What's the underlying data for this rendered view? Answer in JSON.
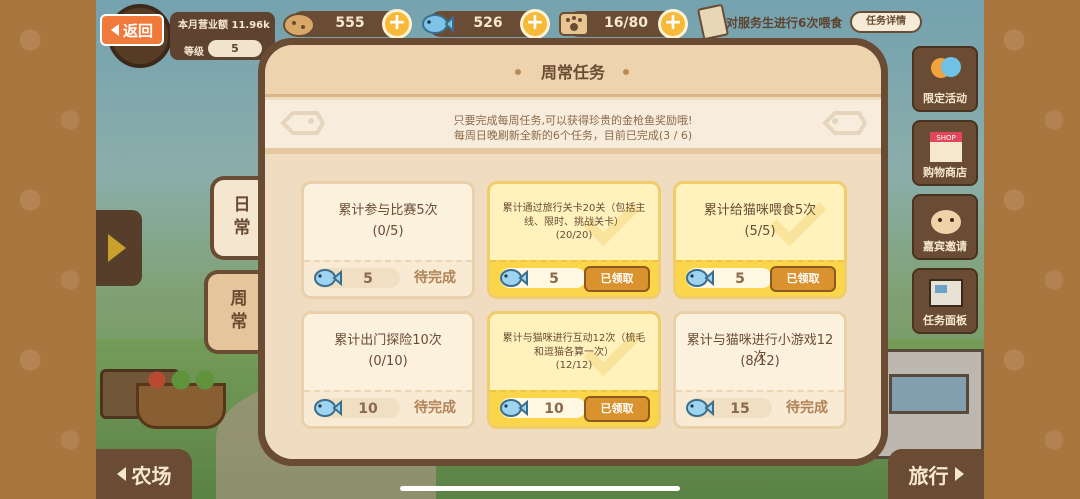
{
  "topbar": {
    "back_label": "返回",
    "revenue_label": "本月营业额 11.96k",
    "level_label": "等级",
    "level_value": "5",
    "cookies": "555",
    "fish": "526",
    "paw": "16/80",
    "task_text": "对服务生进行6次喂食",
    "task_detail_label": "任务详情"
  },
  "side_menu": [
    {
      "label": "限定活动",
      "icon": "balloon-icon"
    },
    {
      "label": "购物商店",
      "icon": "shop-icon"
    },
    {
      "label": "嘉宾邀请",
      "icon": "hamster-icon"
    },
    {
      "label": "任务面板",
      "icon": "board-icon"
    }
  ],
  "bottom_nav": {
    "left_label": "农场",
    "right_label": "旅行"
  },
  "tabs": {
    "daily": "日常",
    "weekly": "周常"
  },
  "modal": {
    "title": "周常任务",
    "desc_line1": "只要完成每周任务,可以获得珍贵的金枪鱼奖励哦!",
    "desc_line2": "每周日晚刷新全新的6个任务，目前已完成(3 / 6)",
    "tasks": [
      {
        "title": "累计参与比赛5次",
        "progress": "(0/5)",
        "reward": "5",
        "status": "待完成",
        "done": false
      },
      {
        "title": "累计通过旅行关卡20关（包括主线、限时、挑战关卡）",
        "progress": "(20/20)",
        "reward": "5",
        "status": "已领取",
        "done": true
      },
      {
        "title": "累计给猫咪喂食5次",
        "progress": "(5/5)",
        "reward": "5",
        "status": "已领取",
        "done": true
      },
      {
        "title": "累计出门探险10次",
        "progress": "(0/10)",
        "reward": "10",
        "status": "待完成",
        "done": false
      },
      {
        "title": "累计与猫咪进行互动12次（梳毛和逗猫各算一次）",
        "progress": "(12/12)",
        "reward": "10",
        "status": "已领取",
        "done": true
      },
      {
        "title": "累计与猫咪进行小游戏12次",
        "progress": "(8/12)",
        "reward": "15",
        "status": "待完成",
        "done": false
      }
    ]
  },
  "colors": {
    "accent": "#f07a3b",
    "frame": "#6a4c34",
    "done_bg": "#fbd64b",
    "claimed_btn": "#d9922e"
  }
}
